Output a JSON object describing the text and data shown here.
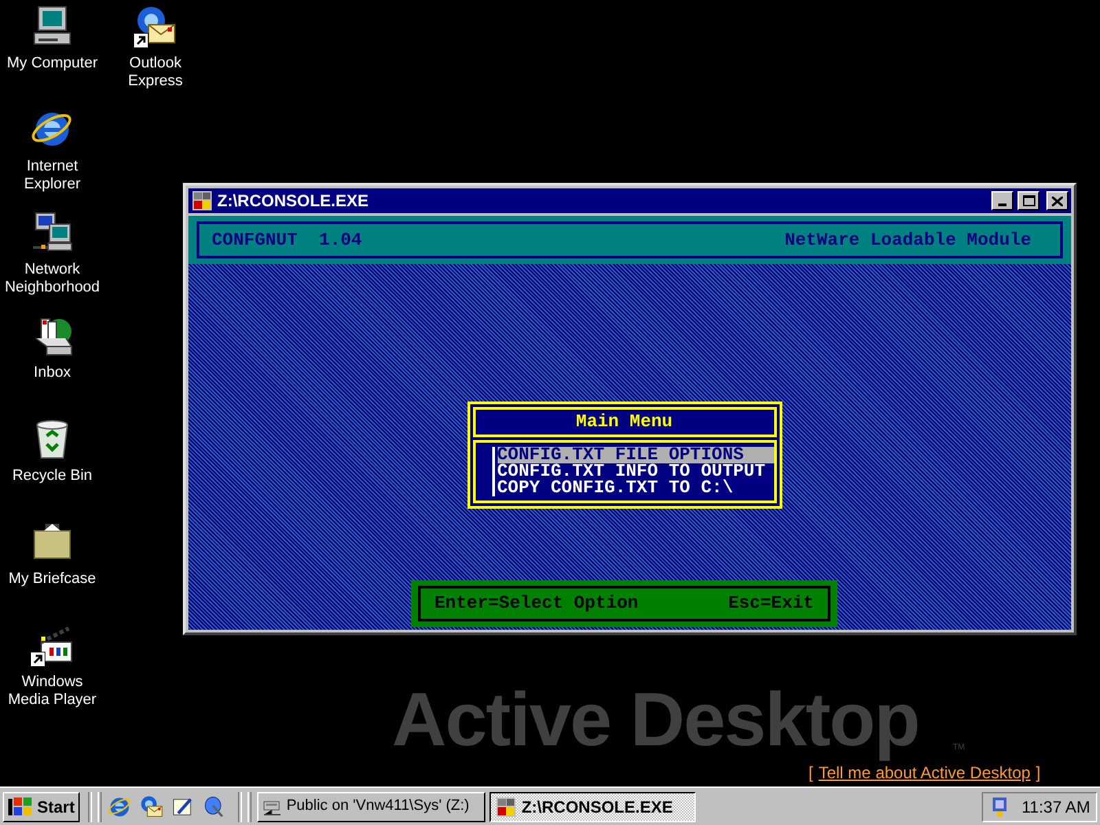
{
  "desktop_icons": [
    {
      "label": "My Computer",
      "kind": "computer"
    },
    {
      "label": "Outlook Express",
      "kind": "mail",
      "shortcut": true
    },
    {
      "label": "Internet Explorer",
      "kind": "globe"
    },
    {
      "label": "Network Neighborhood",
      "kind": "network"
    },
    {
      "label": "Inbox",
      "kind": "inbox"
    },
    {
      "label": "Recycle Bin",
      "kind": "recycle"
    },
    {
      "label": "My Briefcase",
      "kind": "briefcase"
    },
    {
      "label": "Windows Media Player",
      "kind": "media",
      "shortcut": true
    }
  ],
  "window": {
    "title": "Z:\\RCONSOLE.EXE",
    "header": {
      "left": "CONFGNUT  1.04",
      "right": "NetWare Loadable Module"
    },
    "menu": {
      "title": "Main Menu",
      "items": [
        {
          "label": "CONFIG.TXT FILE OPTIONS",
          "selected": true
        },
        {
          "label": "CONFIG.TXT INFO TO OUTPUT",
          "selected": false
        },
        {
          "label": "COPY CONFIG.TXT TO C:\\",
          "selected": false
        }
      ]
    },
    "status": {
      "left": "Enter=Select Option",
      "right": "Esc=Exit"
    }
  },
  "active_desktop": {
    "logo": "Active Desktop",
    "trademark": "TM",
    "link_open": "[",
    "link": "Tell me about Active Desktop",
    "link_close": "]"
  },
  "taskbar": {
    "start": "Start",
    "quick_launch": [
      {
        "kind": "globe"
      },
      {
        "kind": "mail"
      },
      {
        "kind": "desktop"
      },
      {
        "kind": "channel"
      }
    ],
    "tasks": [
      {
        "label": "Public on 'Vnw411\\Sys' (Z:)",
        "kind": "drive",
        "selected": false
      },
      {
        "label": "Z:\\RCONSOLE.EXE",
        "kind": "dos",
        "selected": true
      }
    ],
    "clock": "11:37 AM"
  }
}
